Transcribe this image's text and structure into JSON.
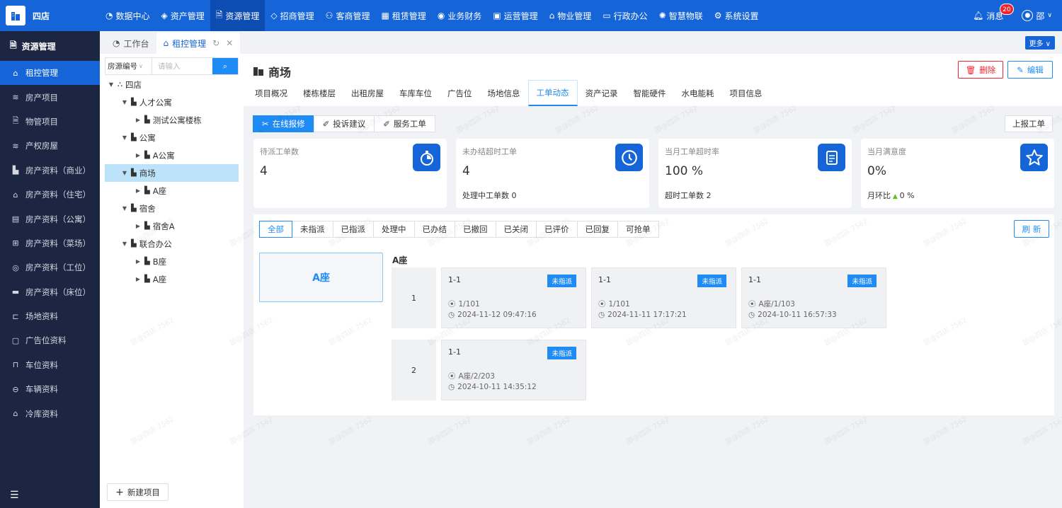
{
  "app": {
    "name": "四店"
  },
  "topnav": [
    {
      "label": "数据中心",
      "icon": "dashboard-icon",
      "active": false
    },
    {
      "label": "资产管理",
      "icon": "cube-icon",
      "active": false
    },
    {
      "label": "资源管理",
      "icon": "document-icon",
      "active": true
    },
    {
      "label": "招商管理",
      "icon": "tag-icon",
      "active": false
    },
    {
      "label": "客商管理",
      "icon": "users-icon",
      "active": false
    },
    {
      "label": "租赁管理",
      "icon": "building-icon",
      "active": false
    },
    {
      "label": "业务财务",
      "icon": "money-icon",
      "active": false
    },
    {
      "label": "运营管理",
      "icon": "image-icon",
      "active": false
    },
    {
      "label": "物业管理",
      "icon": "home-icon",
      "active": false
    },
    {
      "label": "行政办公",
      "icon": "monitor-icon",
      "active": false
    },
    {
      "label": "智慧物联",
      "icon": "network-icon",
      "active": false
    },
    {
      "label": "系统设置",
      "icon": "gear-icon",
      "active": false
    }
  ],
  "topright": {
    "messages_label": "消息",
    "messages_count": "20",
    "user_name": "邵"
  },
  "sidebar": {
    "title": "资源管理",
    "items": [
      {
        "label": "租控管理",
        "icon": "home-icon",
        "active": true
      },
      {
        "label": "房产项目",
        "icon": "layers-icon",
        "active": false
      },
      {
        "label": "物管项目",
        "icon": "document-icon",
        "active": false
      },
      {
        "label": "产权房屋",
        "icon": "layers-icon",
        "active": false
      },
      {
        "label": "房产资料（商业）",
        "icon": "shop-icon",
        "active": false
      },
      {
        "label": "房产资料（住宅）",
        "icon": "house-icon",
        "active": false
      },
      {
        "label": "房产资料（公寓）",
        "icon": "apartment-icon",
        "active": false
      },
      {
        "label": "房产资料（菜场）",
        "icon": "market-icon",
        "active": false
      },
      {
        "label": "房产资料（工位）",
        "icon": "chair-icon",
        "active": false
      },
      {
        "label": "房产资料（床位）",
        "icon": "bed-icon",
        "active": false
      },
      {
        "label": "场地资料",
        "icon": "field-icon",
        "active": false
      },
      {
        "label": "广告位资料",
        "icon": "billboard-icon",
        "active": false
      },
      {
        "label": "车位资料",
        "icon": "parking-icon",
        "active": false
      },
      {
        "label": "车辆资料",
        "icon": "car-icon",
        "active": false
      },
      {
        "label": "冷库资料",
        "icon": "warehouse-icon",
        "active": false
      }
    ]
  },
  "tabs": [
    {
      "label": "工作台",
      "active": false
    },
    {
      "label": "租控管理",
      "active": true
    }
  ],
  "more_label": "更多",
  "tree": {
    "select_label": "房源编号",
    "search_placeholder": "请输入",
    "nodes": [
      {
        "label": "四店",
        "level": 0,
        "arrow": "▼",
        "selected": false
      },
      {
        "label": "人才公寓",
        "level": 1,
        "arrow": "▼",
        "selected": false
      },
      {
        "label": "测试公寓楼栋",
        "level": 2,
        "arrow": "▶",
        "selected": false
      },
      {
        "label": "公寓",
        "level": 1,
        "arrow": "▼",
        "selected": false
      },
      {
        "label": "A公寓",
        "level": 2,
        "arrow": "▶",
        "selected": false
      },
      {
        "label": "商场",
        "level": 1,
        "arrow": "▼",
        "selected": true
      },
      {
        "label": "A座",
        "level": 2,
        "arrow": "▶",
        "selected": false
      },
      {
        "label": "宿舍",
        "level": 1,
        "arrow": "▼",
        "selected": false
      },
      {
        "label": "宿舍A",
        "level": 2,
        "arrow": "▶",
        "selected": false
      },
      {
        "label": "联合办公",
        "level": 1,
        "arrow": "▼",
        "selected": false
      },
      {
        "label": "B座",
        "level": 2,
        "arrow": "▶",
        "selected": false
      },
      {
        "label": "A座",
        "level": 2,
        "arrow": "▶",
        "selected": false
      }
    ],
    "new_project_label": "新建项目"
  },
  "main": {
    "title": "商场",
    "delete_label": "删除",
    "edit_label": "编辑",
    "subtabs": [
      {
        "label": "项目概况",
        "active": false
      },
      {
        "label": "楼栋楼层",
        "active": false
      },
      {
        "label": "出租房屋",
        "active": false
      },
      {
        "label": "车库车位",
        "active": false
      },
      {
        "label": "广告位",
        "active": false
      },
      {
        "label": "场地信息",
        "active": false
      },
      {
        "label": "工单动态",
        "active": true
      },
      {
        "label": "资产记录",
        "active": false
      },
      {
        "label": "智能硬件",
        "active": false
      },
      {
        "label": "水电能耗",
        "active": false
      },
      {
        "label": "项目信息",
        "active": false
      }
    ]
  },
  "workorder": {
    "tabs": [
      {
        "label": "在线报修",
        "icon": "wrench-icon",
        "active": true
      },
      {
        "label": "投诉建议",
        "icon": "pen-icon",
        "active": false
      },
      {
        "label": "服务工单",
        "icon": "pen-icon",
        "active": false
      }
    ],
    "report_label": "上报工单",
    "stats": [
      {
        "label": "待派工单数",
        "value": "4",
        "sub": "",
        "icon": "stopwatch-icon"
      },
      {
        "label": "未办结超时工单",
        "value": "4",
        "sub": "处理中工单数 0",
        "icon": "clock-icon"
      },
      {
        "label": "当月工单超时率",
        "value": "100 %",
        "sub": "超时工单数 2",
        "icon": "clipboard-icon"
      },
      {
        "label": "当月满意度",
        "value": "0%",
        "sub": "月环比",
        "sub_change": "0 %",
        "icon": "star-icon"
      }
    ],
    "filters": [
      {
        "label": "全部",
        "active": true
      },
      {
        "label": "未指派",
        "active": false
      },
      {
        "label": "已指派",
        "active": false
      },
      {
        "label": "处理中",
        "active": false
      },
      {
        "label": "已办结",
        "active": false
      },
      {
        "label": "已撤回",
        "active": false
      },
      {
        "label": "已关闭",
        "active": false
      },
      {
        "label": "已评价",
        "active": false
      },
      {
        "label": "已回复",
        "active": false
      },
      {
        "label": "可抢单",
        "active": false
      }
    ],
    "refresh_label": "刷 新",
    "block_label": "A座",
    "floor_title": "A座",
    "floors": [
      {
        "floor": "1",
        "cards": [
          {
            "room": "1-1",
            "status": "未指派",
            "location": "1/101",
            "time": "2024-11-12 09:47:16"
          },
          {
            "room": "1-1",
            "status": "未指派",
            "location": "1/101",
            "time": "2024-11-11 17:17:21"
          },
          {
            "room": "1-1",
            "status": "未指派",
            "location": "A座/1/103",
            "time": "2024-10-11 16:57:33"
          }
        ]
      },
      {
        "floor": "2",
        "cards": [
          {
            "room": "1-1",
            "status": "未指派",
            "location": "A座/2/203",
            "time": "2024-10-11 14:35:12"
          }
        ]
      }
    ]
  },
  "watermark": "邵@四店 7562"
}
